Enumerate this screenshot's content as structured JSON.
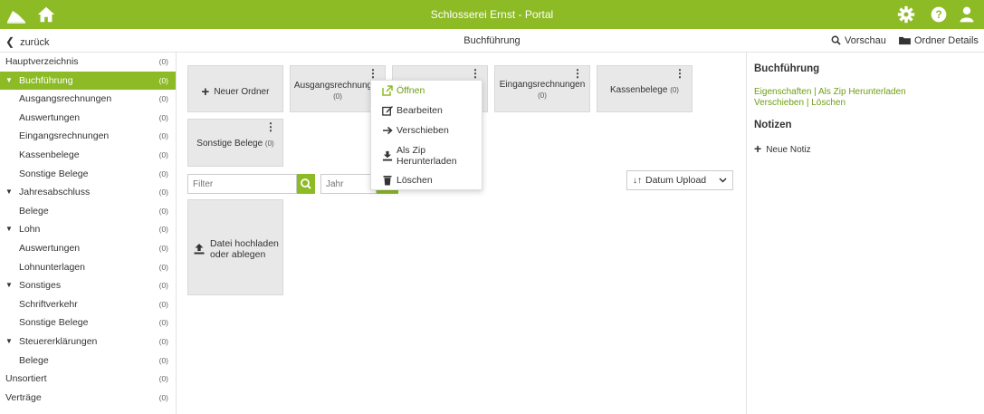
{
  "topbar": {
    "title": "Schlosserei Ernst - Portal"
  },
  "subbar": {
    "back": "zurück",
    "breadcrumb": "Buchführung",
    "preview": "Vorschau",
    "folder_details": "Ordner Details"
  },
  "sidebar": {
    "items": [
      {
        "label": "Hauptverzeichnis",
        "count": "(0)"
      },
      {
        "label": "Buchführung",
        "count": "(0)"
      },
      {
        "label": "Ausgangsrechnungen",
        "count": "(0)"
      },
      {
        "label": "Auswertungen",
        "count": "(0)"
      },
      {
        "label": "Eingangsrechnungen",
        "count": "(0)"
      },
      {
        "label": "Kassenbelege",
        "count": "(0)"
      },
      {
        "label": "Sonstige Belege",
        "count": "(0)"
      },
      {
        "label": "Jahresabschluss",
        "count": "(0)"
      },
      {
        "label": "Belege",
        "count": "(0)"
      },
      {
        "label": "Lohn",
        "count": "(0)"
      },
      {
        "label": "Auswertungen",
        "count": "(0)"
      },
      {
        "label": "Lohnunterlagen",
        "count": "(0)"
      },
      {
        "label": "Sonstiges",
        "count": "(0)"
      },
      {
        "label": "Schriftverkehr",
        "count": "(0)"
      },
      {
        "label": "Sonstige Belege",
        "count": "(0)"
      },
      {
        "label": "Steuererklärungen",
        "count": "(0)"
      },
      {
        "label": "Belege",
        "count": "(0)"
      },
      {
        "label": "Unsortiert",
        "count": "(0)"
      },
      {
        "label": "Verträge",
        "count": "(0)"
      }
    ]
  },
  "tiles": {
    "new_folder": "Neuer Ordner",
    "folders": [
      {
        "name": "Ausgangsrechnung",
        "count": "(0)"
      },
      {
        "name": "Eingangsrechnungen",
        "count": "(0)"
      },
      {
        "name": "Kassenbelege",
        "count": "(0)"
      },
      {
        "name": "Sonstige Belege",
        "count": "(0)"
      }
    ]
  },
  "filter": {
    "placeholder": "Filter",
    "year_placeholder": "Jahr",
    "sort": "Datum Upload"
  },
  "upload": {
    "line1": "Datei hochladen",
    "line2": "oder ablegen"
  },
  "context_menu": {
    "open": "Öffnen",
    "edit": "Bearbeiten",
    "move": "Verschieben",
    "zip_line1": "Als Zip",
    "zip_line2": "Herunterladen",
    "delete": "Löschen"
  },
  "right_panel": {
    "title": "Buchführung",
    "properties": "Eigenschaften",
    "sep": " | ",
    "zip_download": "Als Zip Herunterladen",
    "move": "Verschieben",
    "delete": "Löschen",
    "notes_title": "Notizen",
    "new_note": "Neue Notiz"
  },
  "colors": {
    "accent": "#8dbb26",
    "link": "#6e9e14",
    "tile": "#e8e8e8"
  },
  "icons": [
    "logo-icon",
    "home-icon",
    "gear-icon",
    "help-icon",
    "user-icon",
    "search-icon",
    "folder-icon",
    "plus-icon",
    "upload-icon",
    "sort-icon",
    "external-link-icon",
    "edit-icon",
    "arrow-right-icon",
    "download-icon",
    "trash-icon"
  ]
}
